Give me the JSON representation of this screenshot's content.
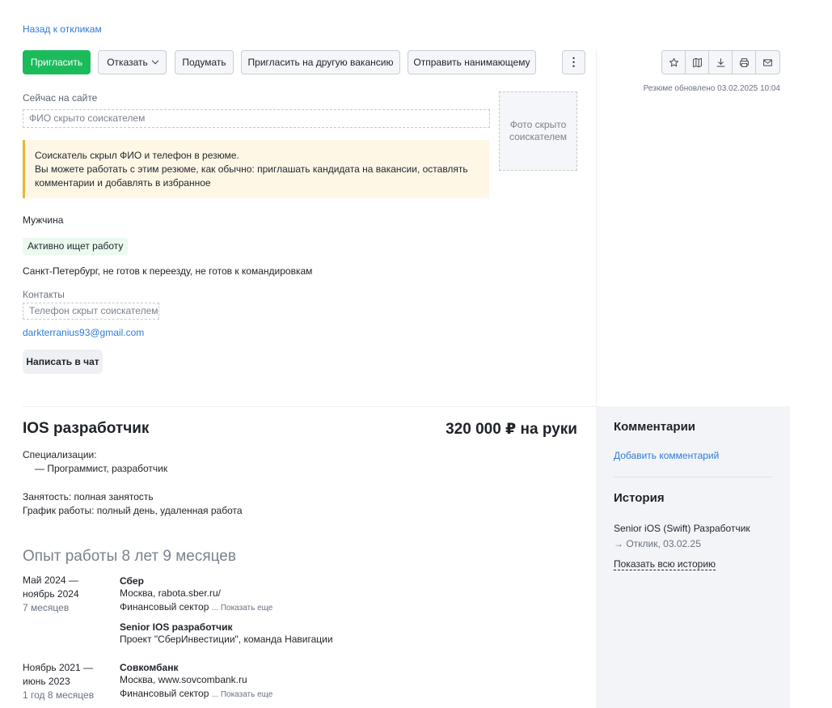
{
  "nav": {
    "back_link": "Назад к откликам"
  },
  "toolbar": {
    "invite": "Пригласить",
    "reject": "Отказать",
    "think": "Подумать",
    "invite_other": "Пригласить на другую вакансию",
    "send_to_manager": "Отправить нанимающему",
    "more": "⋮"
  },
  "icons": [
    "star-icon",
    "map-icon",
    "download-icon",
    "print-icon",
    "mail-icon"
  ],
  "resume_updated": "Резюме обновлено 03.02.2025 10:04",
  "profile": {
    "now_on_site": "Сейчас на сайте",
    "fio_placeholder": "ФИО скрыто соискателем",
    "photo_placeholder": "Фото скрыто соискателем",
    "notice_line1": "Соискатель скрыл ФИО и телефон в резюме.",
    "notice_line2": "Вы можете работать с этим резюме, как обычно: приглашать кандидата на вакансии, оставлять",
    "notice_line3": "комментарии и добавлять в избранное",
    "gender": "Мужчина",
    "status_badge": "Активно ищет работу",
    "location": "Санкт-Петербург, не готов к переезду, не готов к командировкам",
    "contacts_label": "Контакты",
    "phone_placeholder": "Телефон скрыт соискателем",
    "email": "darkterranius93@gmail.com",
    "chat_button": "Написать в чат"
  },
  "position": {
    "title": "IOS разработчик",
    "salary": "320 000 ₽ на руки",
    "spec_label": "Специализации:",
    "spec_item": "— Программист, разработчик",
    "employment": "Занятость: полная занятость",
    "schedule": "График работы: полный день, удаленная работа"
  },
  "experience": {
    "title": "Опыт работы 8 лет 9 месяцев",
    "show_more": "... Показать еще",
    "items": [
      {
        "date_line1": "Май 2024 —",
        "date_line2": "ноябрь 2024",
        "duration": "7 месяцев",
        "company": "Сбер",
        "location": "Москва, rabota.sber.ru/",
        "sector": "Финансовый сектор",
        "role": "Senior IOS разработчик",
        "description": "Проект \"СберИнвестиции\", команда Навигации"
      },
      {
        "date_line1": "Ноябрь 2021 —",
        "date_line2": "июнь 2023",
        "duration": "1 год 8 месяцев",
        "company": "Совкомбанк",
        "location": "Москва, www.sovcombank.ru",
        "sector": "Финансовый сектор"
      }
    ]
  },
  "sidebar": {
    "comments_title": "Комментарии",
    "add_comment": "Добавить комментарий",
    "history_title": "История",
    "history_vacancy": "Senior iOS (Swift) Разработчик",
    "history_event": "→ Отклик, 03.02.25",
    "show_all_history": "Показать всю историю"
  },
  "colors": {
    "primary_green": "#1bbb5c",
    "link_blue": "#2f7bd8",
    "notice_bg": "#fef7e6",
    "notice_border": "#e8b634",
    "sidebar_bg": "#f2f4f8"
  }
}
